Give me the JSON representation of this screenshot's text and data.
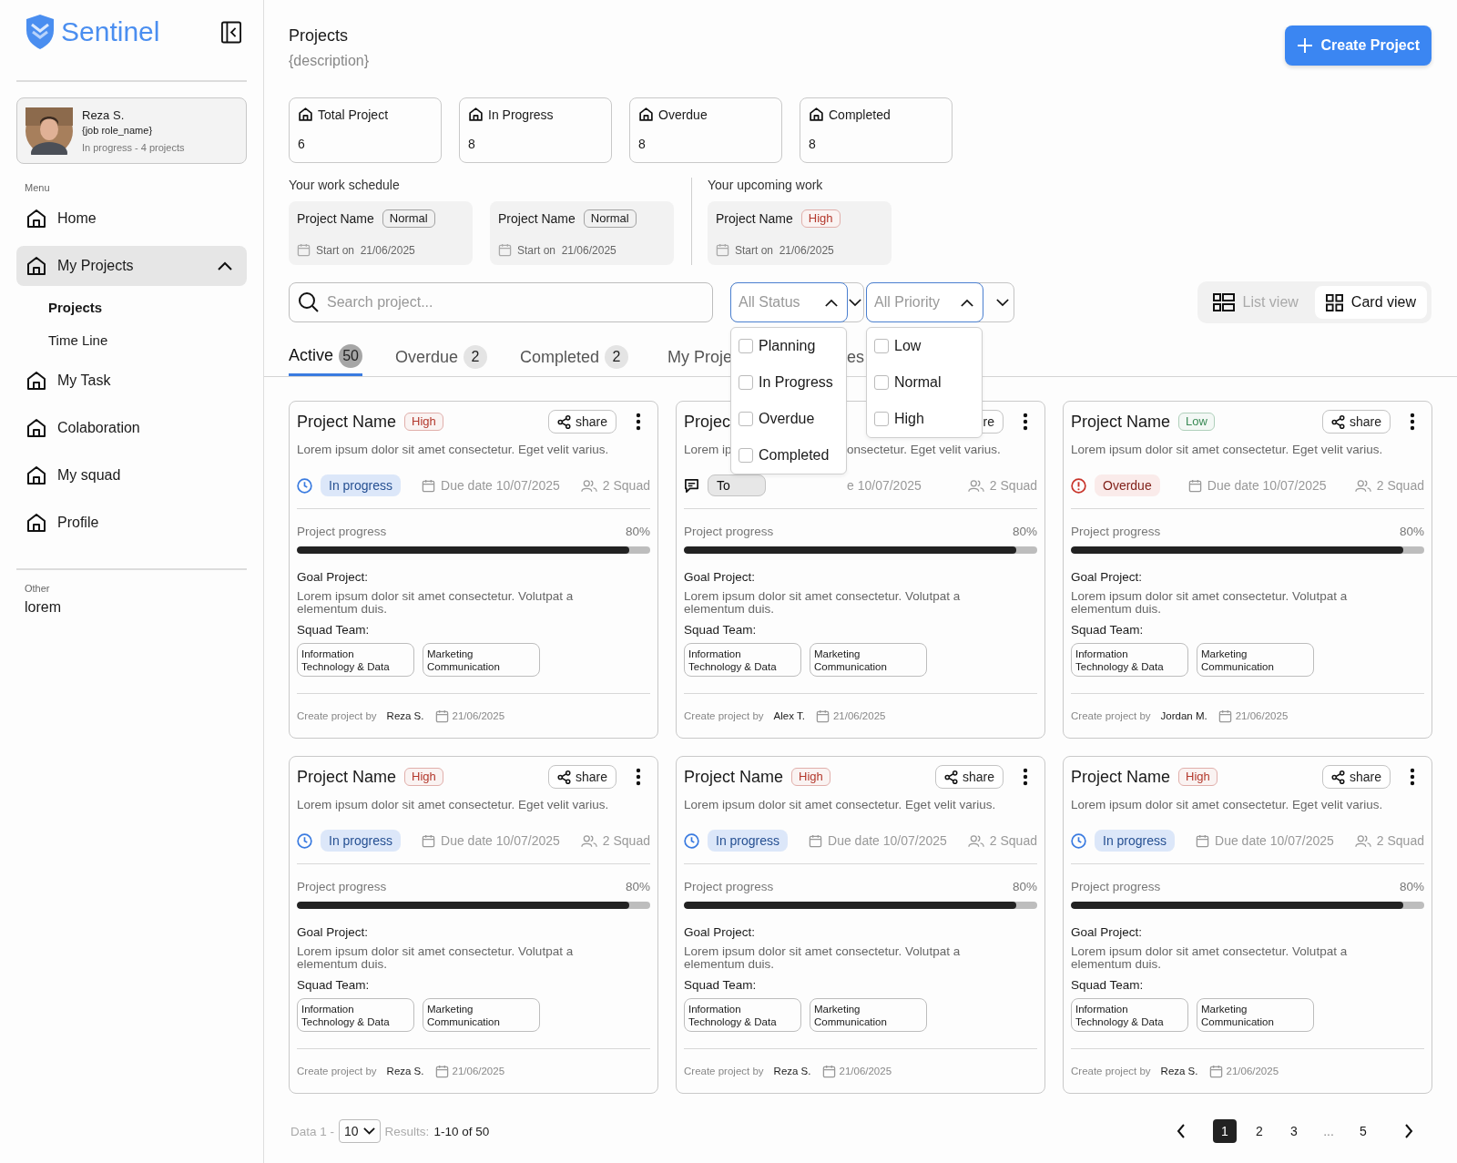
{
  "brand": {
    "name": "Sentinel"
  },
  "user": {
    "name": "Reza S.",
    "role": "{job role_name}",
    "status": "In progress - 4 projects"
  },
  "menu_label": "Menu",
  "menu": [
    {
      "label": "Home",
      "selected": false
    },
    {
      "label": "My Projects",
      "selected": true,
      "expanded": true,
      "children": [
        {
          "label": "Projects",
          "selected": true
        },
        {
          "label": "Time Line",
          "selected": false
        }
      ]
    },
    {
      "label": "My Task",
      "selected": false
    },
    {
      "label": "Colaboration",
      "selected": false
    },
    {
      "label": "My squad",
      "selected": false
    },
    {
      "label": "Profile",
      "selected": false
    }
  ],
  "other_label": "Other",
  "other_items": [
    "lorem"
  ],
  "page": {
    "title": "Projects",
    "description": "{description}",
    "create_button": "Create Project"
  },
  "stats": [
    {
      "label": "Total Project",
      "value": "6"
    },
    {
      "label": "In Progress",
      "value": "8"
    },
    {
      "label": "Overdue",
      "value": "8"
    },
    {
      "label": "Completed",
      "value": "8"
    }
  ],
  "schedule": {
    "title": "Your work schedule",
    "items": [
      {
        "name": "Project Name",
        "priority": {
          "label": "Normal",
          "color": "#1a1a1a"
        },
        "start_label": "Start on",
        "date": "21/06/2025"
      },
      {
        "name": "Project Name",
        "priority": {
          "label": "Normal",
          "color": "#1a1a1a"
        },
        "start_label": "Start on",
        "date": "21/06/2025"
      }
    ]
  },
  "upcoming": {
    "title": "Your upcoming work",
    "items": [
      {
        "name": "Project Name",
        "priority": {
          "label": "High",
          "color": "#b3382c"
        },
        "start_label": "Start on",
        "date": "21/06/2025"
      }
    ]
  },
  "search": {
    "placeholder": "Search project..."
  },
  "filters": [
    {
      "placeholder": "All Status",
      "expanded": true,
      "options": [
        {
          "label": "Planning",
          "checked": false
        },
        {
          "label": "In Progress",
          "checked": false
        },
        {
          "label": "Overdue",
          "checked": false
        },
        {
          "label": "Completed",
          "checked": false
        }
      ]
    },
    {
      "placeholder": "All Priority",
      "expanded": true,
      "options": [
        {
          "label": "Low",
          "checked": false
        },
        {
          "label": "Normal",
          "checked": false
        },
        {
          "label": "High",
          "checked": false
        }
      ]
    }
  ],
  "views": [
    {
      "label": "List view",
      "kind": "list",
      "selected": false
    },
    {
      "label": "Card view",
      "kind": "card",
      "selected": true
    }
  ],
  "tabs": [
    {
      "label": "Active",
      "count": "50",
      "selected": true
    },
    {
      "label": "Overdue",
      "count": "2",
      "selected": false
    },
    {
      "label": "Completed",
      "count": "2",
      "selected": false
    },
    {
      "label": "My Proje",
      "label_tail": "es",
      "selected": false
    }
  ],
  "cards": [
    {
      "kind": "full",
      "name": "Project Name",
      "priority": {
        "label": "High",
        "color": "#b3382c"
      },
      "share": "share",
      "description": "Lorem ipsum dolor sit amet consectetur. Eget velit varius.",
      "status": {
        "kind": "progress",
        "label": "In progress",
        "color": "#3a7be0"
      },
      "due_label": "Due date",
      "due": "10/07/2025",
      "squad": "2 Squad",
      "progress_label": "Project progress",
      "progress_text": "80%",
      "level": 0.94,
      "goal_label": "Goal Project:",
      "goal": "Lorem ipsum dolor sit amet consectetur. Volutpat a elementum duis.",
      "team_label": "Squad Team:",
      "teams": [
        "Information Technology & Data",
        "Marketing Communication"
      ],
      "created_label": "Create project by",
      "creator": "Reza S.",
      "created": "21/06/2025"
    },
    {
      "kind": "partial",
      "name": "Projec",
      "share": "re",
      "description": "Lorem ip",
      "description_tail": "onsectetur. Eget velit varius.",
      "status": {
        "kind": "todo",
        "label": "To",
        "color": "#111111"
      },
      "due": "e 10/07/2025",
      "squad": "2 Squad",
      "progress_label": "Project progress",
      "progress_text": "80%",
      "level": 0.94,
      "goal_label": "Goal Project:",
      "goal": "Lorem ipsum dolor sit amet consectetur. Volutpat a elementum duis.",
      "team_label": "Squad Team:",
      "teams": [
        "Information Technology & Data",
        "Marketing Communication"
      ],
      "created_label": "Create project by",
      "creator": "Alex T.",
      "created": "21/06/2025"
    },
    {
      "kind": "full",
      "name": "Project Name",
      "priority": {
        "label": "Low",
        "color": "#3a8a55"
      },
      "share": "share",
      "description": "Lorem ipsum dolor sit amet consectetur. Eget velit varius.",
      "status": {
        "kind": "overdue",
        "label": "Overdue",
        "color": "#c8342a"
      },
      "due_label": "Due date",
      "due": "10/07/2025",
      "squad": "2 Squad",
      "progress_label": "Project progress",
      "progress_text": "80%",
      "level": 0.94,
      "goal_label": "Goal Project:",
      "goal": "Lorem ipsum dolor sit amet consectetur. Volutpat a elementum duis.",
      "team_label": "Squad Team:",
      "teams": [
        "Information Technology & Data",
        "Marketing Communication"
      ],
      "created_label": "Create project by",
      "creator": "Jordan M.",
      "created": "21/06/2025"
    },
    {
      "kind": "full",
      "name": "Project Name",
      "priority": {
        "label": "High",
        "color": "#b3382c"
      },
      "share": "share",
      "description": "Lorem ipsum dolor sit amet consectetur. Eget velit varius.",
      "status": {
        "kind": "progress",
        "label": "In progress",
        "color": "#3a7be0"
      },
      "due_label": "Due date",
      "due": "10/07/2025",
      "squad": "2 Squad",
      "progress_label": "Project progress",
      "progress_text": "80%",
      "level": 0.94,
      "goal_label": "Goal Project:",
      "goal": "Lorem ipsum dolor sit amet consectetur. Volutpat a elementum duis.",
      "team_label": "Squad Team:",
      "teams": [
        "Information Technology & Data",
        "Marketing Communication"
      ],
      "created_label": "Create project by",
      "creator": "Reza S.",
      "created": "21/06/2025"
    },
    {
      "kind": "full",
      "name": "Project Name",
      "priority": {
        "label": "High",
        "color": "#b3382c"
      },
      "share": "share",
      "description": "Lorem ipsum dolor sit amet consectetur. Eget velit varius.",
      "status": {
        "kind": "progress",
        "label": "In progress",
        "color": "#3a7be0"
      },
      "due_label": "Due date",
      "due": "10/07/2025",
      "squad": "2 Squad",
      "progress_label": "Project progress",
      "progress_text": "80%",
      "level": 0.94,
      "goal_label": "Goal Project:",
      "goal": "Lorem ipsum dolor sit amet consectetur. Volutpat a elementum duis.",
      "team_label": "Squad Team:",
      "teams": [
        "Information Technology & Data",
        "Marketing Communication"
      ],
      "created_label": "Create project by",
      "creator": "Reza S.",
      "created": "21/06/2025"
    },
    {
      "kind": "full",
      "name": "Project Name",
      "priority": {
        "label": "High",
        "color": "#b3382c"
      },
      "share": "share",
      "description": "Lorem ipsum dolor sit amet consectetur. Eget velit varius.",
      "status": {
        "kind": "progress",
        "label": "In progress",
        "color": "#3a7be0"
      },
      "due_label": "Due date",
      "due": "10/07/2025",
      "squad": "2 Squad",
      "progress_label": "Project progress",
      "progress_text": "80%",
      "level": 0.94,
      "goal_label": "Goal Project:",
      "goal": "Lorem ipsum dolor sit amet consectetur. Volutpat a elementum duis.",
      "team_label": "Squad Team:",
      "teams": [
        "Information Technology & Data",
        "Marketing Communication"
      ],
      "created_label": "Create project by",
      "creator": "Reza S.",
      "created": "21/06/2025"
    }
  ],
  "pagination": {
    "data_label": "Data 1 -",
    "page_size": "10",
    "results_label": "Results:",
    "results": "1-10 of 50",
    "pages": [
      {
        "label": "1",
        "kind": "page",
        "selected": true
      },
      {
        "label": "2",
        "kind": "page",
        "selected": false
      },
      {
        "label": "3",
        "kind": "page",
        "selected": false
      },
      {
        "label": "...",
        "kind": "gap"
      },
      {
        "label": "5",
        "kind": "page",
        "selected": false
      }
    ]
  }
}
